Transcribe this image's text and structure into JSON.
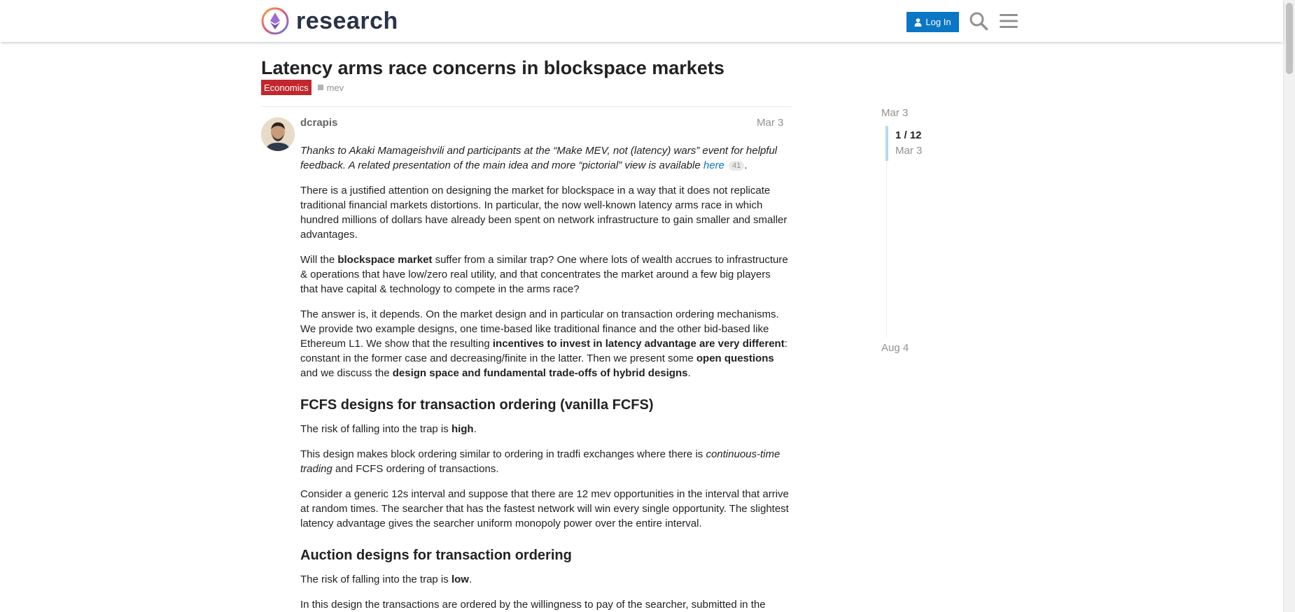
{
  "header": {
    "logo_text": "research",
    "login_label": "Log In",
    "icons": [
      "search-icon",
      "hamburger-menu-icon"
    ]
  },
  "topic": {
    "title": "Latency arms race concerns in blockspace markets",
    "category": "Economics",
    "category_color": "#c1272d",
    "tag": "mev"
  },
  "post": {
    "username": "dcrapis",
    "date": "Mar 3",
    "intro_text": "Thanks to Akaki Mamageishvili and participants at the “Make MEV, not (latency) wars” event for helpful feedback. A related presentation of the main idea and more “pictorial” view is available ",
    "intro_link": "here",
    "intro_link_clicks": "41",
    "intro_end": ".",
    "p1": "There is a justified attention on designing the market for blockspace in a way that it does not replicate traditional financial markets distortions. In particular, the now well-known latency arms race in which hundred millions of dollars have already been spent on network infrastructure to gain smaller and smaller advantages.",
    "p2_a": "Will the ",
    "p2_b": "blockspace market",
    "p2_c": " suffer from a similar trap? One where lots of wealth accrues to infrastructure & operations that have low/zero real utility, and that concentrates the market around a few big players that have capital & technology to compete in the arms race?",
    "p3_a": "The answer is, it depends. On the market design and in particular on transaction ordering mechanisms. We provide two example designs, one time-based like traditional finance and the other bid-based like Ethereum L1. We show that the resulting ",
    "p3_b": "incentives to invest in latency advantage are very different",
    "p3_c": ": constant in the former case and decreasing/finite in the latter. Then we present some ",
    "p3_d": "open questions",
    "p3_e": " and we discuss the ",
    "p3_f": "design space and fundamental trade-offs of hybrid designs",
    "p3_g": ".",
    "h1": "FCFS designs for transaction ordering (vanilla FCFS)",
    "p4_a": "The risk of falling into the trap is ",
    "p4_b": "high",
    "p4_c": ".",
    "p5_a": "This design makes block ordering similar to ordering in tradfi exchanges where there is ",
    "p5_b": "continuous-time trading",
    "p5_c": " and FCFS ordering of transactions.",
    "p6": "Consider a generic 12s interval and suppose that there are 12 mev opportunities in the interval that arrive at random times. The searcher that has the fastest network will win every single opportunity. The slightest latency advantage gives the searcher uniform monopoly power over the entire interval.",
    "h2": "Auction designs for transaction ordering",
    "p7_a": "The risk of falling into the trap is ",
    "p7_b": "low",
    "p7_c": ".",
    "p8": "In this design the transactions are ordered by the willingness to pay of the searcher, submitted in the"
  },
  "timeline": {
    "start_date": "Mar 3",
    "position": "1 / 12",
    "position_date": "Mar 3",
    "end_date": "Aug 4"
  }
}
